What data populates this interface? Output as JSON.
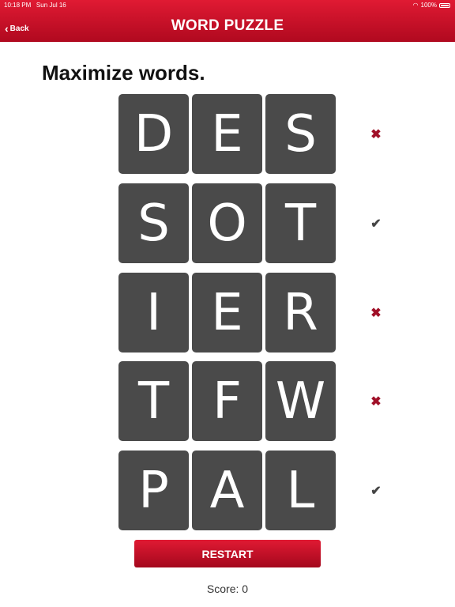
{
  "status_bar": {
    "time": "10:18 PM",
    "date": "Sun Jul 16",
    "battery": "100%"
  },
  "header": {
    "back_label": "Back",
    "title": "WORD PUZZLE"
  },
  "prompt": "Maximize words.",
  "rows": [
    {
      "letters": [
        "D",
        "E",
        "S"
      ],
      "valid": false,
      "mark": "✖"
    },
    {
      "letters": [
        "S",
        "O",
        "T"
      ],
      "valid": true,
      "mark": "✔"
    },
    {
      "letters": [
        "I",
        "E",
        "R"
      ],
      "valid": false,
      "mark": "✖"
    },
    {
      "letters": [
        "T",
        "F",
        "W"
      ],
      "valid": false,
      "mark": "✖"
    },
    {
      "letters": [
        "P",
        "A",
        "L"
      ],
      "valid": true,
      "mark": "✔"
    }
  ],
  "restart_label": "RESTART",
  "score": "Score: 0",
  "colors": {
    "header": "#c8102e",
    "tile": "#4a4a4a",
    "invalid_mark": "#a01028",
    "valid_mark": "#444444"
  }
}
